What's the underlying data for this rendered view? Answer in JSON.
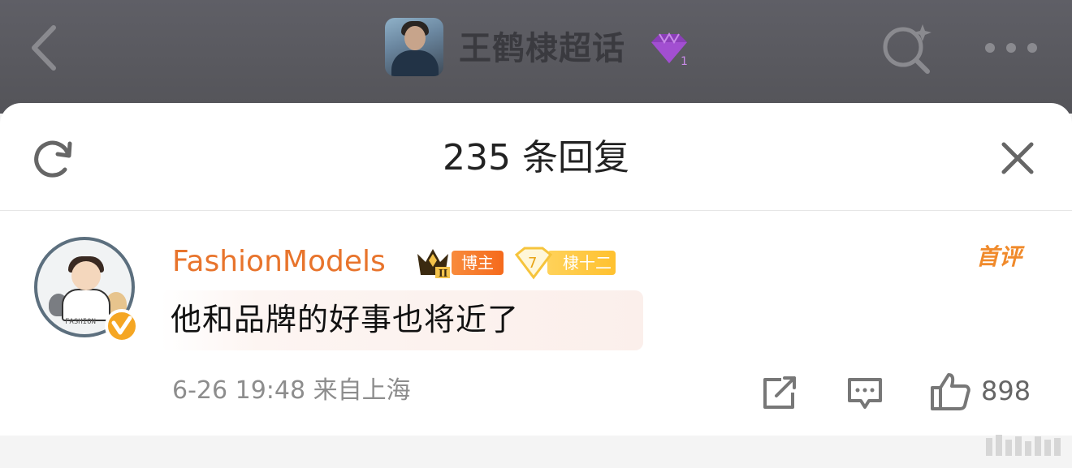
{
  "header": {
    "title": "王鹤棣超话",
    "gem_level": "1",
    "icons": [
      "back-arrow-icon",
      "topic-avatar",
      "gem-icon",
      "search-icon",
      "more-icon"
    ]
  },
  "sheet": {
    "reply_count": "235 条回复",
    "icons": [
      "refresh-icon",
      "close-icon"
    ]
  },
  "comment": {
    "username": "FashionModels",
    "crown_level": "II",
    "badge_blogger": "博主",
    "fan_level": "7",
    "fan_badge": "棣十二",
    "first_comment_label": "首评",
    "text": "他和品牌的好事也将近了",
    "timestamp": "6-26 19:48 来自上海",
    "like_count": "898",
    "colors": {
      "username": "#e8742c",
      "blogger_badge": "#f56a1c",
      "fan_badge": "#ffc12f",
      "verified": "#f5a623"
    },
    "icons": [
      "verified-icon",
      "crown-icon",
      "share-icon",
      "comment-icon",
      "like-icon"
    ]
  }
}
